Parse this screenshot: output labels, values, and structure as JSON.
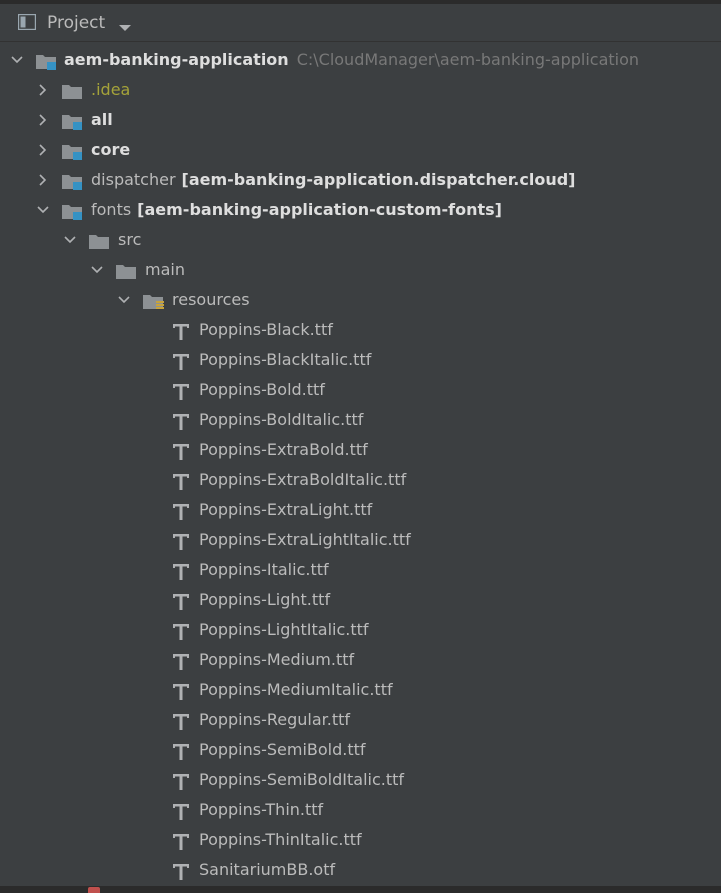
{
  "header": {
    "title": "Project",
    "icon": "project-panel-icon",
    "dropdown_icon": "chevron-down-icon"
  },
  "colors": {
    "background": "#3c3f41",
    "text": "#bbbbbb",
    "bold_text": "#dedede",
    "idea_text": "#a5a33a",
    "path_hint": "#787878",
    "folder": "#8d9194",
    "module_badge": "#3592c4",
    "resources_badge": "#c8a33b"
  },
  "tree": {
    "root": {
      "label": "aem-banking-application",
      "path": "C:\\CloudManager\\aem-banking-application"
    },
    "modules": {
      "idea": ".idea",
      "all": "all",
      "core": "core",
      "dispatcher": "dispatcher",
      "dispatcher_artifact": "[aem-banking-application.dispatcher.cloud]",
      "fonts": "fonts",
      "fonts_artifact": "[aem-banking-application-custom-fonts]"
    },
    "folders": {
      "src": "src",
      "main": "main",
      "resources": "resources"
    },
    "files": [
      "Poppins-Black.ttf",
      "Poppins-BlackItalic.ttf",
      "Poppins-Bold.ttf",
      "Poppins-BoldItalic.ttf",
      "Poppins-ExtraBold.ttf",
      "Poppins-ExtraBoldItalic.ttf",
      "Poppins-ExtraLight.ttf",
      "Poppins-ExtraLightItalic.ttf",
      "Poppins-Italic.ttf",
      "Poppins-Light.ttf",
      "Poppins-LightItalic.ttf",
      "Poppins-Medium.ttf",
      "Poppins-MediumItalic.ttf",
      "Poppins-Regular.ttf",
      "Poppins-SemiBold.ttf",
      "Poppins-SemiBoldItalic.ttf",
      "Poppins-Thin.ttf",
      "Poppins-ThinItalic.ttf",
      "SanitariumBB.otf"
    ]
  }
}
